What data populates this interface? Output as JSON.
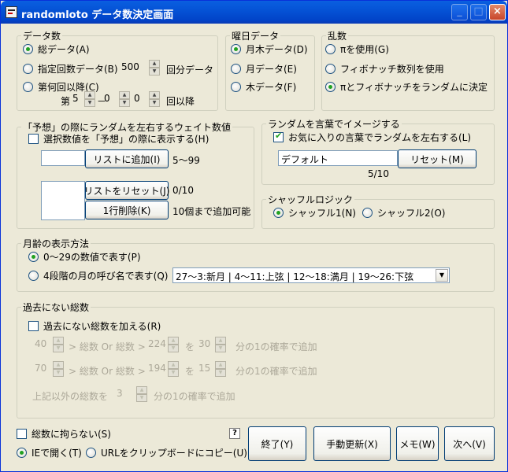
{
  "window": {
    "title": "randomloto データ数決定画面",
    "minimize": "_",
    "maximize": "□",
    "close": "×"
  },
  "data_count": {
    "label": "データ数",
    "opt_all": "総データ(A)",
    "opt_specified": "指定回数データ(B)",
    "specified_value": "500",
    "specified_suffix": "回分データ",
    "opt_after": "第何回以降(C)",
    "after_prefix": "第",
    "after_v1": "5",
    "after_sep": "－",
    "after_v2": "0",
    "after_v3": "0",
    "after_suffix": "回以降"
  },
  "weekday": {
    "label": "曜日データ",
    "opt_montue": "月木データ(D)",
    "opt_mon": "月データ(E)",
    "opt_thu": "木データ(F)"
  },
  "random": {
    "label": "乱数",
    "opt_pi": "πを使用(G)",
    "opt_fib": "フィボナッチ数列を使用",
    "opt_both": "πとフィボナッチをランダムに決定"
  },
  "weight": {
    "label": "「予想」の際にランダムを左右するウェイト数値",
    "show_check": "選択数値を「予想」の際に表示する(H)",
    "add_button": "リストに追加(I)",
    "range_note": "5～99",
    "reset_button": "リストをリセット(J)",
    "count": "0/10",
    "delete_button": "1行削除(K)",
    "max_note": "10個まで追加可能"
  },
  "words": {
    "label": "ランダムを言葉でイメージする",
    "favorite_check": "お気に入りの言葉でランダムを左右する(L)",
    "text_value": "デフォルト",
    "reset_button": "リセット(M)",
    "count": "5/10"
  },
  "shuffle": {
    "label": "シャッフルロジック",
    "opt_1": "シャッフル1(N)",
    "opt_2": "シャッフル2(O)"
  },
  "moon": {
    "label": "月齢の表示方法",
    "opt_number": "0～29の数値で表す(P)",
    "opt_name": "4段階の月の呼び名で表す(Q)",
    "combo_value": "27～3:新月 | 4～11:上弦 | 12～18:満月 | 19～26:下弦"
  },
  "past": {
    "label": "過去にない総数",
    "add_check": "過去にない総数を加える(R)",
    "row1_v": "40",
    "row1_mid": "> 総数 Or 総数 >",
    "row1_v2": "224",
    "row1_wo": "を",
    "row1_v3": "30",
    "row1_suffix": "分の1の確率で追加",
    "row2_v": "70",
    "row2_mid": "> 総数 Or 総数 >",
    "row2_v2": "194",
    "row2_wo": "を",
    "row2_v3": "15",
    "row2_suffix": "分の1の確率で追加",
    "other_prefix": "上記以外の総数を",
    "other_v": "3",
    "other_suffix": "分の1の確率で追加"
  },
  "footer": {
    "no_total_check": "総数に拘らない(S)",
    "help": "?",
    "open_ie": "IEで開く(T)",
    "copy_url": "URLをクリップボードにコピー(U)",
    "end_button": "終了(Y)",
    "manual_button": "手動更新(X)",
    "memo_button": "メモ(W)",
    "next_button": "次へ(V)"
  }
}
